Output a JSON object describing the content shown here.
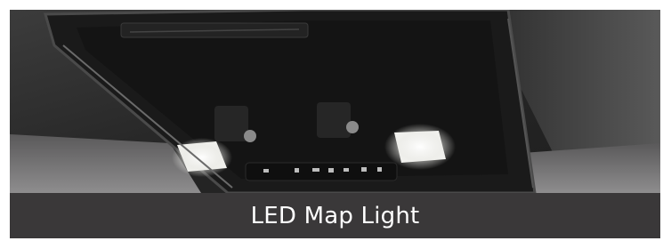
{
  "caption": "LED Map Light",
  "colors": {
    "caption_bg": "#3a3839",
    "caption_text": "#ffffff",
    "headliner": "#6b6a6b",
    "console": "#161616",
    "lamp": "#f4f4f0"
  }
}
